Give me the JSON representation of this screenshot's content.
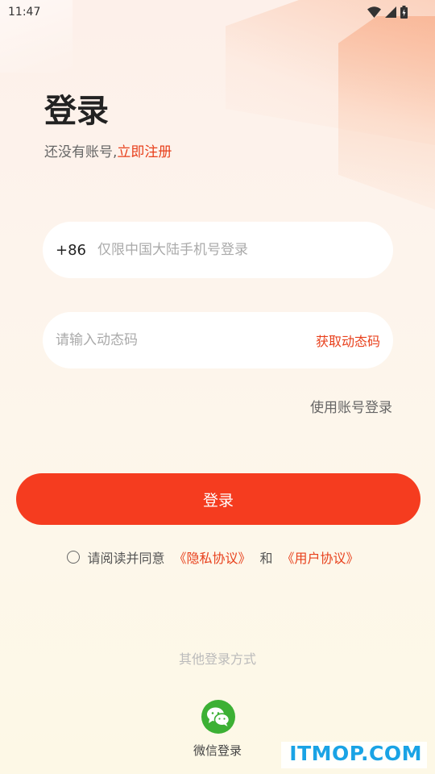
{
  "status_bar": {
    "time": "11:47"
  },
  "header": {
    "title": "登录",
    "subtitle_prefix": "还没有账号,",
    "register_link": "立即注册"
  },
  "phone": {
    "prefix": "+86",
    "placeholder": "仅限中国大陆手机号登录",
    "value": ""
  },
  "code": {
    "placeholder": "请输入动态码",
    "value": "",
    "get_code_label": "获取动态码"
  },
  "account_login_label": "使用账号登录",
  "login_button_label": "登录",
  "agreement": {
    "prefix": "请阅读并同意",
    "privacy_link": "《隐私协议》",
    "conjunction": "和",
    "user_link": "《用户协议》"
  },
  "other_login": {
    "label": "其他登录方式",
    "wechat_label": "微信登录"
  },
  "watermark": "ITMOP.COM",
  "colors": {
    "accent": "#f53c1f",
    "link": "#e8401c",
    "wechat": "#3cb034"
  }
}
